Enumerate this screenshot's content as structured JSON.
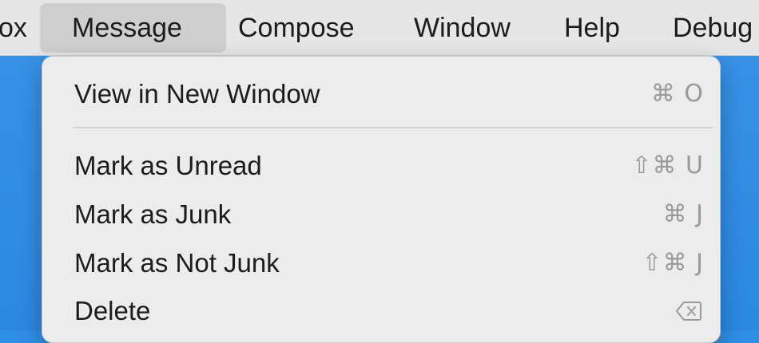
{
  "menubar": {
    "items": [
      {
        "label": "ox"
      },
      {
        "label": "Message"
      },
      {
        "label": "Compose"
      },
      {
        "label": "Window"
      },
      {
        "label": "Help"
      },
      {
        "label": "Debug"
      }
    ],
    "active": "Message"
  },
  "menu": {
    "items": [
      {
        "label": "View in New Window",
        "shortcut": "⌘ O"
      },
      {
        "label": "Mark as Unread",
        "shortcut": "⇧⌘ U"
      },
      {
        "label": "Mark as Junk",
        "shortcut": "⌘ J"
      },
      {
        "label": "Mark as Not Junk",
        "shortcut": "⇧⌘ J"
      },
      {
        "label": "Delete",
        "shortcut_icon": "delete-backward-icon"
      }
    ]
  },
  "colors": {
    "menubar_bg": "#e6e6e6",
    "active_item_bg": "#cfcfcf",
    "menu_bg": "#ececec",
    "shortcut_text": "#9a9a9a",
    "backdrop": "#2f8fe6"
  }
}
